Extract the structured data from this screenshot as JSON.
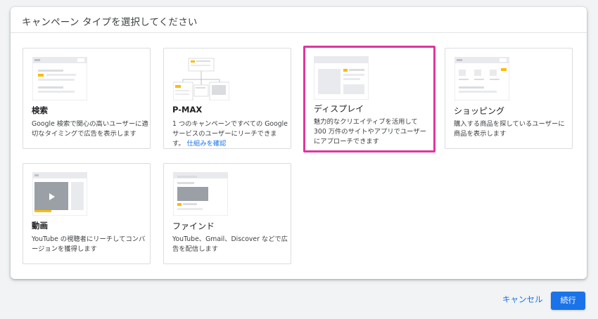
{
  "dialog": {
    "title": "キャンペーン タイプを選択してください"
  },
  "cards": [
    {
      "name": "検索",
      "description": "Google 検索で関心の高いユーザーに適切なタイミングで広告を表示します",
      "selected": false
    },
    {
      "name": "P-MAX",
      "description": "1 つのキャンペーンですべての Google サービスのユーザーにリーチできます。",
      "link": "仕組みを確認",
      "selected": false
    },
    {
      "name": "ディスプレイ",
      "description": "魅力的なクリエイティブを活用して 300 万件のサイトやアプリでユーザーにアプローチできます",
      "selected": true
    },
    {
      "name": "ショッピング",
      "description": "購入する商品を探しているユーザーに商品を表示します",
      "selected": false
    },
    {
      "name": "動画",
      "description": "YouTube の視聴者にリーチしてコンバージョンを獲得します",
      "selected": false
    },
    {
      "name": "ファインド",
      "description": "YouTube、Gmail、Discover などで広告を配信します",
      "selected": false
    }
  ],
  "footer": {
    "cancel_label": "キャンセル",
    "continue_label": "続行"
  },
  "colors": {
    "accent": "#1a73e8",
    "highlight": "#e0359f",
    "illustration_yellow": "#fbbc04",
    "illustration_gray": "#dadce0"
  }
}
